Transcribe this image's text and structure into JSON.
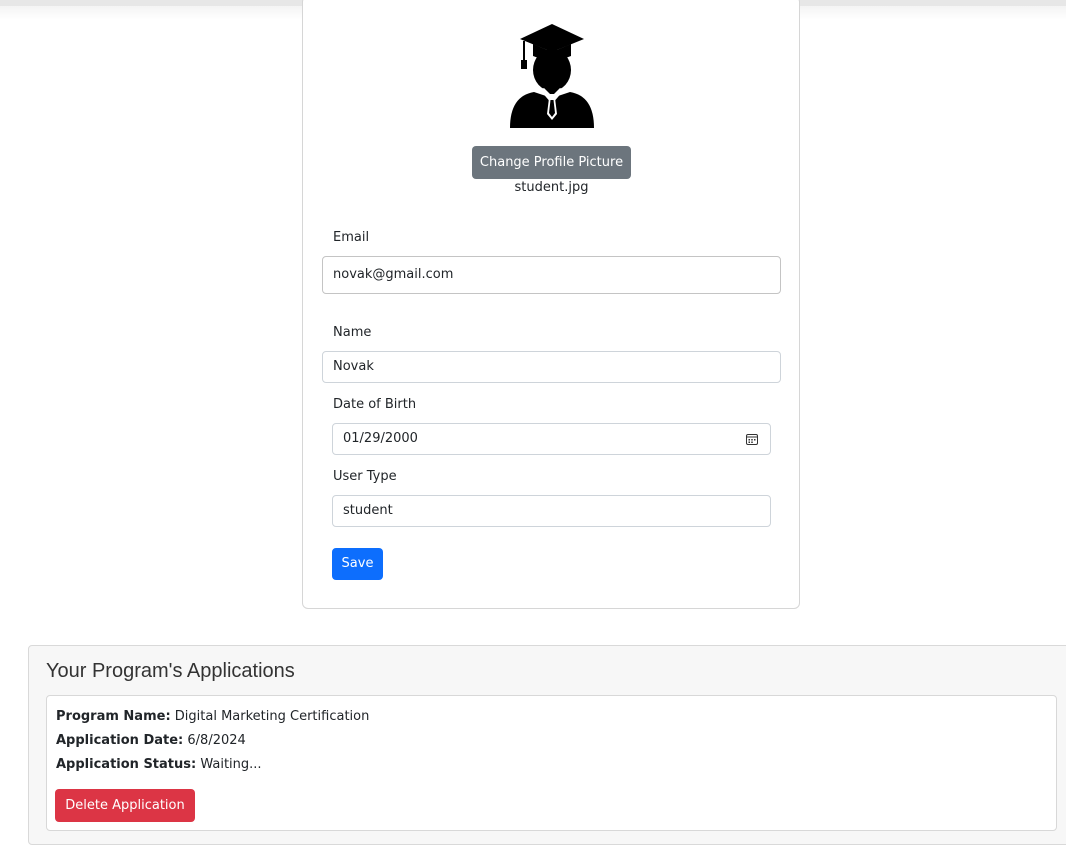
{
  "profile": {
    "avatar_icon": "graduate-student-icon",
    "change_picture_label": "Change Profile Picture",
    "filename": "student.jpg",
    "email_label": "Email",
    "email_value": "novak@gmail.com",
    "name_label": "Name",
    "name_value": "Novak",
    "dob_label": "Date of Birth",
    "dob_value": "01/29/2000",
    "calendar_icon": "calendar-icon",
    "user_type_label": "User Type",
    "user_type_value": "student",
    "save_label": "Save"
  },
  "applications": {
    "title": "Your Program's Applications",
    "items": [
      {
        "program_name_label": "Program Name:",
        "program_name": "Digital Marketing Certification",
        "date_label": "Application Date:",
        "date": "6/8/2024",
        "status_label": "Application Status:",
        "status": "Waiting...",
        "delete_label": "Delete Application"
      }
    ]
  },
  "colors": {
    "secondary": "#6c757d",
    "primary": "#0d6efd",
    "danger": "#dc3545"
  }
}
